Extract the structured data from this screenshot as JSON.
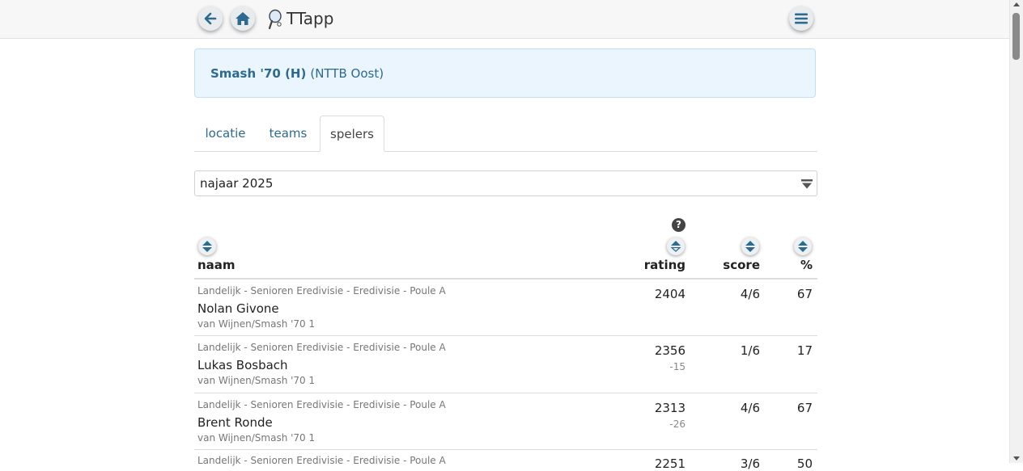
{
  "app": {
    "title": "TTapp",
    "accent": "#2d6a8f"
  },
  "header": {
    "back_icon": "arrow-left-icon",
    "home_icon": "home-icon",
    "menu_icon": "hamburger-icon"
  },
  "club": {
    "name": "Smash '70 (H)",
    "region": "(NTTB Oost)"
  },
  "tabs": [
    {
      "label": "locatie",
      "active": false
    },
    {
      "label": "teams",
      "active": false
    },
    {
      "label": "spelers",
      "active": true
    }
  ],
  "season": {
    "selected": "najaar 2025"
  },
  "table": {
    "headers": {
      "name": "naam",
      "rating": "rating",
      "score": "score",
      "pct": "%"
    },
    "help_icon": "?",
    "rows": [
      {
        "competition": "Landelijk - Senioren Eredivisie - Eredivisie - Poule A",
        "name": "Nolan Givone",
        "team": "van Wijnen/Smash '70 1",
        "rating": "2404",
        "delta": "",
        "score": "4/6",
        "pct": "67"
      },
      {
        "competition": "Landelijk - Senioren Eredivisie - Eredivisie - Poule A",
        "name": "Lukas Bosbach",
        "team": "van Wijnen/Smash '70 1",
        "rating": "2356",
        "delta": "-15",
        "score": "1/6",
        "pct": "17"
      },
      {
        "competition": "Landelijk - Senioren Eredivisie - Eredivisie - Poule A",
        "name": "Brent Ronde",
        "team": "van Wijnen/Smash '70 1",
        "rating": "2313",
        "delta": "-26",
        "score": "4/6",
        "pct": "67"
      },
      {
        "competition": "Landelijk - Senioren Eredivisie - Eredivisie - Poule A",
        "name": "",
        "team": "",
        "rating": "2251",
        "delta": "",
        "score": "3/6",
        "pct": "50"
      }
    ]
  }
}
